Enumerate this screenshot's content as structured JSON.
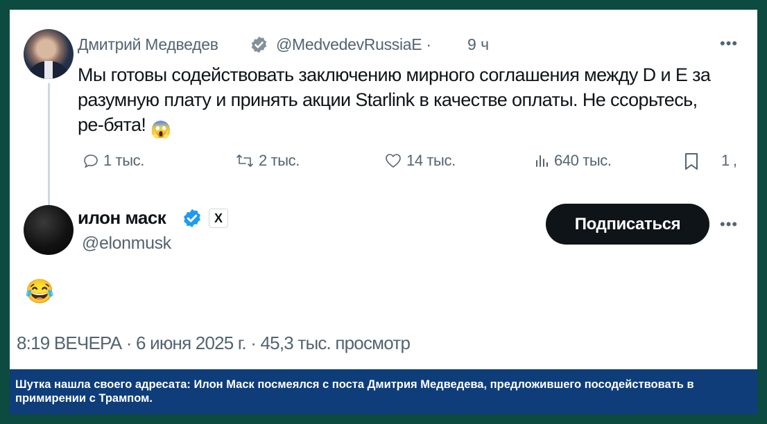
{
  "tweet": {
    "author_name": "Дмитрий Медведев",
    "author_handle": "@MedvedevRussiaE ·",
    "time": "9 ч",
    "text": "Мы готовы содействовать заключению мирного соглашения между D и E за разумную плату и принять акции Starlink в качестве оплаты. Не ссорьтесь, ре-бята!",
    "emoji": "😱",
    "actions": {
      "replies": "1 тыс.",
      "retweets": "2 тыс.",
      "likes": "14 тыс.",
      "views": "640 тыс.",
      "bookmarks": "1"
    }
  },
  "reply": {
    "author_name": "илон маск",
    "author_handle": "@elonmusk",
    "x_badge": "X",
    "follow_label": "Подписаться",
    "emoji": "😂",
    "meta": "8:19 ВЕЧЕРА · 6 июня 2025 г. · 45,3 тыс. просмотр"
  },
  "caption": "Шутка нашла своего адресата: Илон Маск посмеялся с поста Дмитрия Медведева, предложившего посодействовать в примирении с Трампом.",
  "colors": {
    "frame": "#0d4a3f",
    "caption_bg": "#0e3d7a",
    "verified": "#1d9bf0",
    "follow_bg": "#0f1419"
  }
}
